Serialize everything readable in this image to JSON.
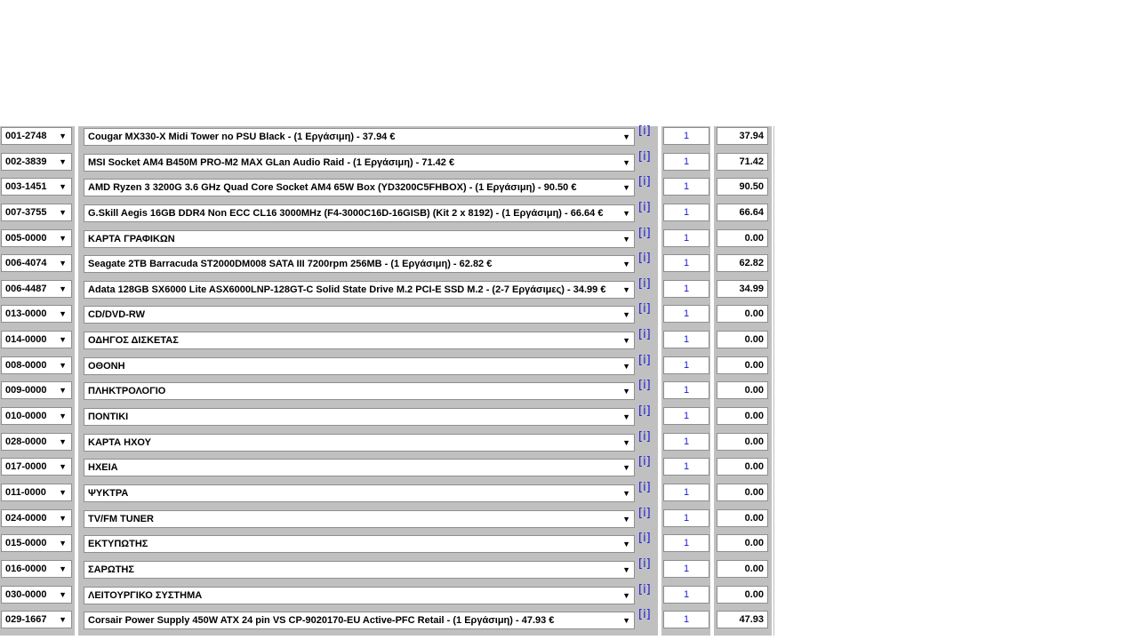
{
  "rows": [
    {
      "code": "001-2748",
      "product": "Cougar MX330-X Midi Tower no PSU Black - (1 Εργάσιμη) - 37.94 €",
      "qty": "1",
      "price": "37.94"
    },
    {
      "code": "002-3839",
      "product": "MSI Socket AM4 B450M PRO-M2 MAX GLan Audio Raid - (1 Εργάσιμη) - 71.42 €",
      "qty": "1",
      "price": "71.42"
    },
    {
      "code": "003-1451",
      "product": "AMD Ryzen 3 3200G 3.6 GHz Quad Core Socket AM4 65W Box (YD3200C5FHBOX) - (1 Εργάσιμη) - 90.50 €",
      "qty": "1",
      "price": "90.50"
    },
    {
      "code": "007-3755",
      "product": "G.Skill Aegis 16GB DDR4 Non ECC CL16 3000MHz (F4-3000C16D-16GISB) (Kit 2 x 8192) - (1 Εργάσιμη) - 66.64 €",
      "qty": "1",
      "price": "66.64"
    },
    {
      "code": "005-0000",
      "product": "ΚΑΡΤΑ ΓΡΑΦΙΚΩΝ",
      "qty": "1",
      "price": "0.00"
    },
    {
      "code": "006-4074",
      "product": "Seagate 2TB Barracuda ST2000DM008 SATA III 7200rpm 256MB - (1 Εργάσιμη) - 62.82 €",
      "qty": "1",
      "price": "62.82"
    },
    {
      "code": "006-4487",
      "product": "Adata 128GB SX6000 Lite ASX6000LNP-128GT-C Solid State Drive M.2 PCI-E SSD M.2 - (2-7 Εργάσιμες) - 34.99 €",
      "qty": "1",
      "price": "34.99"
    },
    {
      "code": "013-0000",
      "product": "CD/DVD-RW",
      "qty": "1",
      "price": "0.00"
    },
    {
      "code": "014-0000",
      "product": "ΟΔΗΓΟΣ ΔΙΣΚΕΤΑΣ",
      "qty": "1",
      "price": "0.00"
    },
    {
      "code": "008-0000",
      "product": "ΟΘΟΝΗ",
      "qty": "1",
      "price": "0.00"
    },
    {
      "code": "009-0000",
      "product": "ΠΛΗΚΤΡΟΛΟΓΙΟ",
      "qty": "1",
      "price": "0.00"
    },
    {
      "code": "010-0000",
      "product": "ΠΟΝΤΙΚΙ",
      "qty": "1",
      "price": "0.00"
    },
    {
      "code": "028-0000",
      "product": "ΚΑΡΤΑ ΗΧΟΥ",
      "qty": "1",
      "price": "0.00"
    },
    {
      "code": "017-0000",
      "product": "ΗΧΕΙΑ",
      "qty": "1",
      "price": "0.00"
    },
    {
      "code": "011-0000",
      "product": "ΨΥΚΤΡΑ",
      "qty": "1",
      "price": "0.00"
    },
    {
      "code": "024-0000",
      "product": "TV/FM TUNER",
      "qty": "1",
      "price": "0.00"
    },
    {
      "code": "015-0000",
      "product": "ΕΚΤΥΠΩΤΗΣ",
      "qty": "1",
      "price": "0.00"
    },
    {
      "code": "016-0000",
      "product": "ΣΑΡΩΤΗΣ",
      "qty": "1",
      "price": "0.00"
    },
    {
      "code": "030-0000",
      "product": "ΛΕΙΤΟΥΡΓΙΚΟ ΣΥΣΤΗΜΑ",
      "qty": "1",
      "price": "0.00"
    },
    {
      "code": "029-1667",
      "product": "Corsair Power Supply 450W ATX 24 pin VS CP-9020170-EU Active-PFC Retail - (1 Εργάσιμη) - 47.93 €",
      "qty": "1",
      "price": "47.93"
    }
  ],
  "info_label": "[i]",
  "dropdown_glyph": "▼"
}
